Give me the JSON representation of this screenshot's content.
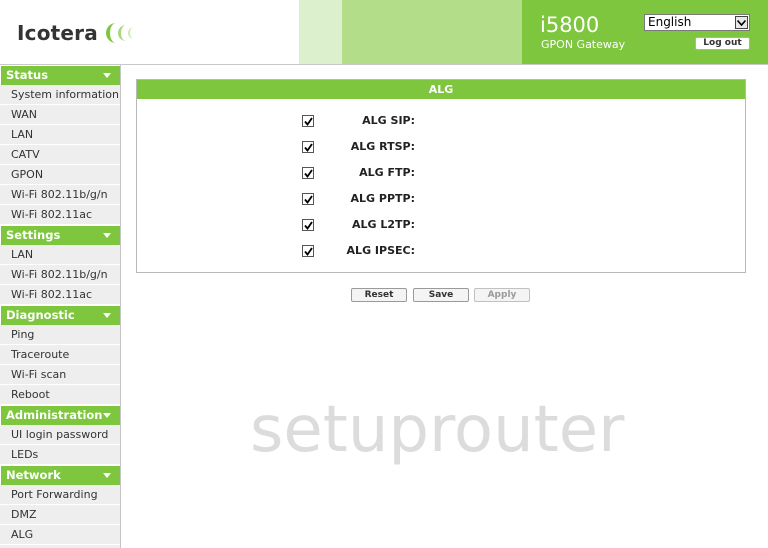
{
  "header": {
    "brand": "Icotera",
    "model": "i5800",
    "model_sub": "GPON Gateway",
    "language": "English",
    "logout_label": "Log out",
    "accent": "#7dc63e"
  },
  "sidebar": {
    "sections": [
      {
        "title": "Status",
        "items": [
          "System information",
          "WAN",
          "LAN",
          "CATV",
          "GPON",
          "Wi-Fi 802.11b/g/n",
          "Wi-Fi 802.11ac"
        ]
      },
      {
        "title": "Settings",
        "items": [
          "LAN",
          "Wi-Fi 802.11b/g/n",
          "Wi-Fi 802.11ac"
        ]
      },
      {
        "title": "Diagnostic",
        "items": [
          "Ping",
          "Traceroute",
          "Wi-Fi scan",
          "Reboot"
        ]
      },
      {
        "title": "Administration",
        "items": [
          "UI login password",
          "LEDs"
        ]
      },
      {
        "title": "Network",
        "items": [
          "Port Forwarding",
          "DMZ",
          "ALG"
        ]
      }
    ]
  },
  "main": {
    "panel_title": "ALG",
    "options": [
      {
        "label": "ALG SIP:",
        "checked": true
      },
      {
        "label": "ALG RTSP:",
        "checked": true
      },
      {
        "label": "ALG FTP:",
        "checked": true
      },
      {
        "label": "ALG PPTP:",
        "checked": true
      },
      {
        "label": "ALG L2TP:",
        "checked": true
      },
      {
        "label": "ALG IPSEC:",
        "checked": true
      }
    ],
    "buttons": {
      "reset": "Reset",
      "save": "Save",
      "apply": "Apply"
    }
  },
  "watermark": "setuprouter"
}
